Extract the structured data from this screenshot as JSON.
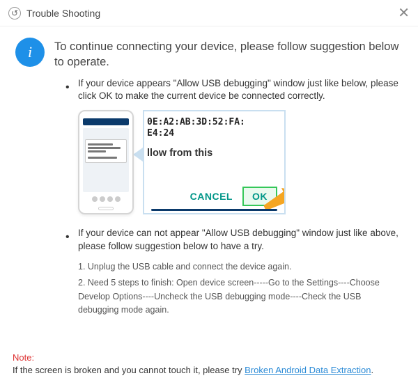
{
  "titlebar": {
    "title": "Trouble Shooting",
    "close_glyph": "✕"
  },
  "lead": "To continue connecting your device, please follow suggestion below to operate.",
  "bullets": [
    "If your device appears \"Allow USB debugging\" window just like below, please click OK to make the current device  be connected correctly.",
    "If your device can not appear \"Allow USB debugging\" window just like above, please follow suggestion below to have a try."
  ],
  "zoom_panel": {
    "fingerprint_line1": "0E:A2:AB:3D:52:FA:",
    "fingerprint_line2": "E4:24",
    "allow_text": "llow from this",
    "cancel": "CANCEL",
    "ok": "OK"
  },
  "numbered": [
    "1. Unplug the USB cable and connect the device again.",
    "2. Need 5 steps to finish: Open device screen-----Go to the Settings----Choose Develop Options----Uncheck the USB debugging mode----Check the USB debugging mode again."
  ],
  "footer": {
    "note_label": "Note:",
    "text": "If the screen is broken and you cannot touch it, please try ",
    "link": "Broken Android Data Extraction",
    "suffix": "."
  }
}
